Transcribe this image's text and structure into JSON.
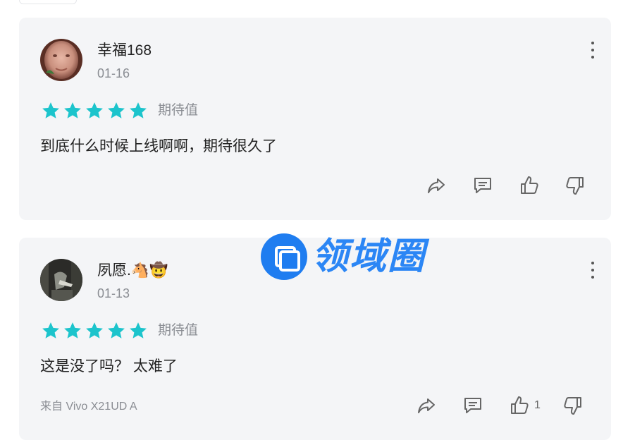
{
  "colors": {
    "star": "#1cc4cc",
    "card_bg": "#f4f5f7",
    "text_primary": "#222222",
    "text_secondary": "#8a8d93",
    "watermark": "#1f7df0"
  },
  "reviews": [
    {
      "username": "幸福168",
      "date": "01-16",
      "stars": 5,
      "rating_label": "期待值",
      "text": "到底什么时候上线啊啊，期待很久了",
      "source": "",
      "like_count": "",
      "avatar_icon": "photo-avatar-face",
      "actions": [
        "share-icon",
        "comment-icon",
        "thumbs-up-icon",
        "thumbs-down-icon"
      ]
    },
    {
      "username": "夙愿.🐴🤠",
      "date": "01-13",
      "stars": 5,
      "rating_label": "期待值",
      "text": "这是没了吗？  太难了",
      "source": "来自 Vivo X21UD A",
      "like_count": "1",
      "avatar_icon": "photo-avatar-dark",
      "actions": [
        "share-icon",
        "comment-icon",
        "thumbs-up-icon",
        "thumbs-down-icon"
      ]
    }
  ],
  "watermark": {
    "text": "领域圈",
    "icon": "overlapping-squares-logo"
  }
}
